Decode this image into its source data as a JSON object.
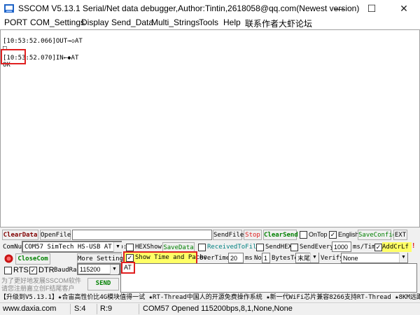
{
  "window": {
    "title": "SSCOM V5.13.1 Serial/Net data debugger,Author:Tintin,2618058@qq.com(Newest version)"
  },
  "menu": [
    "PORT",
    "COM_Settings",
    "Display",
    "Send_Data",
    "Multi_Strings",
    "Tools",
    "Help",
    "联系作者",
    "大虾论坛"
  ],
  "log": {
    "lines": [
      "[10:53:52.066]OUT→◇AT",
      "□",
      "[10:53:52.070]IN←◆AT",
      "OK"
    ]
  },
  "row1": {
    "clear_data": "ClearData",
    "open_file": "OpenFile",
    "send_file": "SendFile",
    "stop": "Stop",
    "clear_send": "ClearSend",
    "on_top": "OnTop",
    "english": "English",
    "save_config": "SaveConfig",
    "ext": "EXT"
  },
  "row2": {
    "com_num_label": "ComNum",
    "com_value": "COM57 SimTech HS-USB AT Po:",
    "hex_show": "HEXShow",
    "save_data": "SaveData",
    "received_to_file": "ReceivedToFile",
    "send_hex": "SendHEX",
    "send_every": "SendEvery:",
    "send_every_value": "1000",
    "ms_tim": "ms/Tim",
    "add_crlf": "AddCrLf"
  },
  "row3": {
    "close_com": "CloseCom",
    "more_settings": "More Settings",
    "show_time": "Show Time and Packe",
    "overtime": "OverTime:",
    "overtime_value": "20",
    "ms": "ms",
    "no": "No",
    "bytes_value": "1",
    "bytes_to": "BytesTo",
    "tail_value": "末尾",
    "verify": "Verify",
    "verify_value": "None"
  },
  "row4": {
    "rts": "RTS",
    "dtr": "DTR",
    "baud_label": "BaudRat",
    "baud_value": "115200",
    "send_text": "AT"
  },
  "promo": {
    "line1": "为了更好地发展SSCOM软件",
    "line2": "请您注册嘉立创F结尾客户",
    "send": "SEND"
  },
  "ticker": "【升级到V5.13.1】★合宙高性价比4G模块值得一试 ★RT-Thread中国人的开源免费操作系统 ★新一代WiFi芯片兼容8266支持RT-Thread ★8KM远距",
  "status": {
    "url": "www.daxia.com",
    "s": "S:4",
    "r": "R:9",
    "port_info": "COM57 Opened  115200bps,8,1,None,None"
  },
  "colors": {
    "red": "#e02020",
    "green": "#008000",
    "yellow": "#ffff66",
    "maroon": "#800000"
  }
}
